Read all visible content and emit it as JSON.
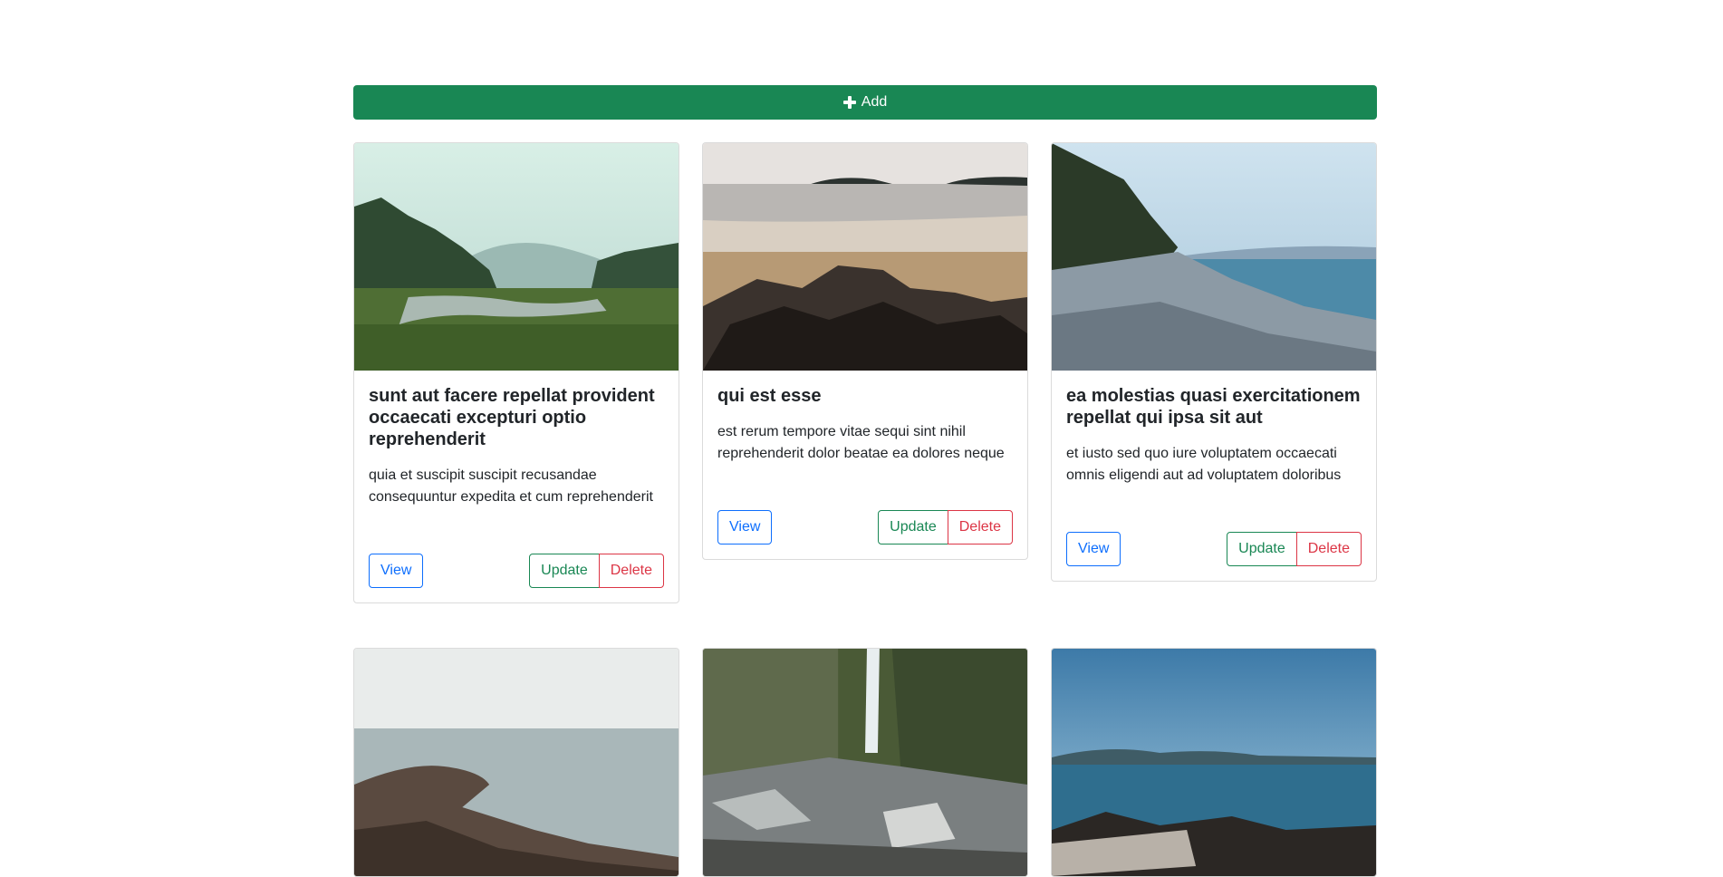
{
  "toolbar": {
    "add_label": "Add"
  },
  "colors": {
    "primary": "#0d6efd",
    "success": "#198754",
    "danger": "#dc3545"
  },
  "posts": [
    {
      "title": "sunt aut facere repellat provident occaecati excepturi optio reprehenderit",
      "body": "quia et suscipit suscipit recusandae consequuntur expedita et cum reprehenderit",
      "image": "misty-valley-river-photo",
      "view_label": "View",
      "update_label": "Update",
      "delete_label": "Delete"
    },
    {
      "title": "qui est esse",
      "body": "est rerum tempore vitae sequi sint nihil reprehenderit dolor beatae ea dolores neque",
      "image": "beach-rocks-photo",
      "view_label": "View",
      "update_label": "Update",
      "delete_label": "Delete"
    },
    {
      "title": "ea molestias quasi exercitationem repellat qui ipsa sit aut",
      "body": "et iusto sed quo iure voluptatem occaecati omnis eligendi aut ad voluptatem doloribus",
      "image": "pebble-shore-photo",
      "view_label": "View",
      "update_label": "Update",
      "delete_label": "Delete"
    },
    {
      "image": "rocky-coast-photo"
    },
    {
      "image": "waterfall-gorge-photo"
    },
    {
      "image": "lake-rocks-logs-photo"
    }
  ]
}
